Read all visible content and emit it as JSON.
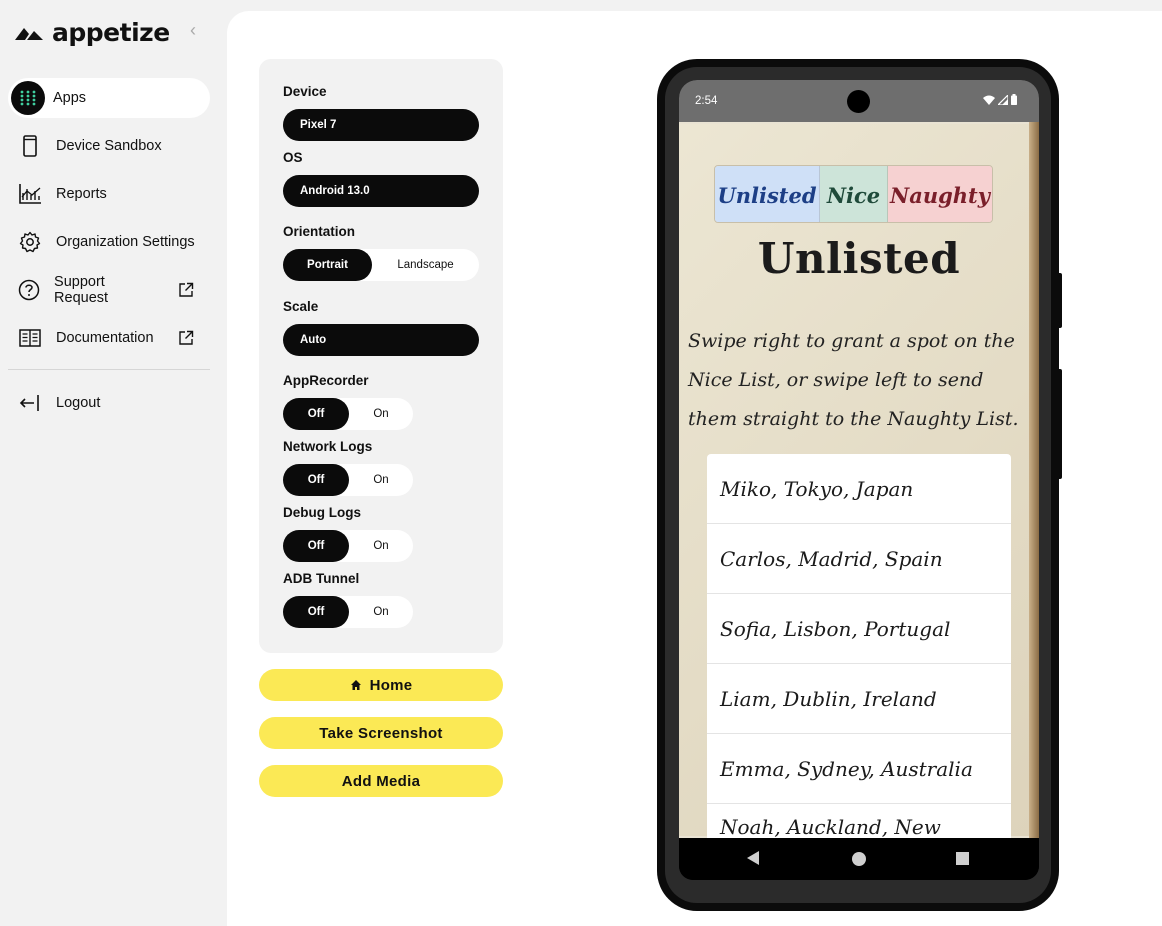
{
  "brand": {
    "name": "appetize"
  },
  "sidebar": {
    "items": [
      {
        "label": "Apps",
        "icon": "grid-icon",
        "active": true
      },
      {
        "label": "Device Sandbox",
        "icon": "phone-icon"
      },
      {
        "label": "Reports",
        "icon": "chart-icon"
      },
      {
        "label": "Organization Settings",
        "icon": "gear-icon"
      },
      {
        "label": "Support Request",
        "icon": "question-icon",
        "external": true
      },
      {
        "label": "Documentation",
        "icon": "book-icon",
        "external": true
      }
    ],
    "logout": "Logout"
  },
  "settings": {
    "device": {
      "label": "Device",
      "value": "Pixel 7"
    },
    "os": {
      "label": "OS",
      "value": "Android 13.0"
    },
    "orientation": {
      "label": "Orientation",
      "options": [
        "Portrait",
        "Landscape"
      ],
      "selected": "Portrait"
    },
    "scale": {
      "label": "Scale",
      "value": "Auto"
    },
    "app_recorder": {
      "label": "AppRecorder",
      "off": "Off",
      "on": "On",
      "selected": "Off"
    },
    "network_logs": {
      "label": "Network Logs",
      "off": "Off",
      "on": "On",
      "selected": "Off"
    },
    "debug_logs": {
      "label": "Debug Logs",
      "off": "Off",
      "on": "On",
      "selected": "Off"
    },
    "adb_tunnel": {
      "label": "ADB Tunnel",
      "off": "Off",
      "on": "On",
      "selected": "Off"
    }
  },
  "actions": {
    "home": "Home",
    "screenshot": "Take Screenshot",
    "add_media": "Add Media"
  },
  "phone": {
    "status_time": "2:54",
    "app": {
      "tabs": [
        "Unlisted",
        "Nice",
        "Naughty"
      ],
      "heading": "Unlisted",
      "description": "Swipe right to grant a spot on the Nice List, or swipe left to send them straight to the Naughty List.",
      "list": [
        "Miko, Tokyo, Japan",
        "Carlos, Madrid, Spain",
        "Sofia, Lisbon, Portugal",
        "Liam, Dublin, Ireland",
        "Emma, Sydney, Australia",
        "Noah, Auckland, New Zealand"
      ]
    }
  },
  "colors": {
    "accent_yellow": "#fbe955",
    "dark": "#0b0b0b",
    "apps_icon_dots": "#3fd0a0"
  }
}
